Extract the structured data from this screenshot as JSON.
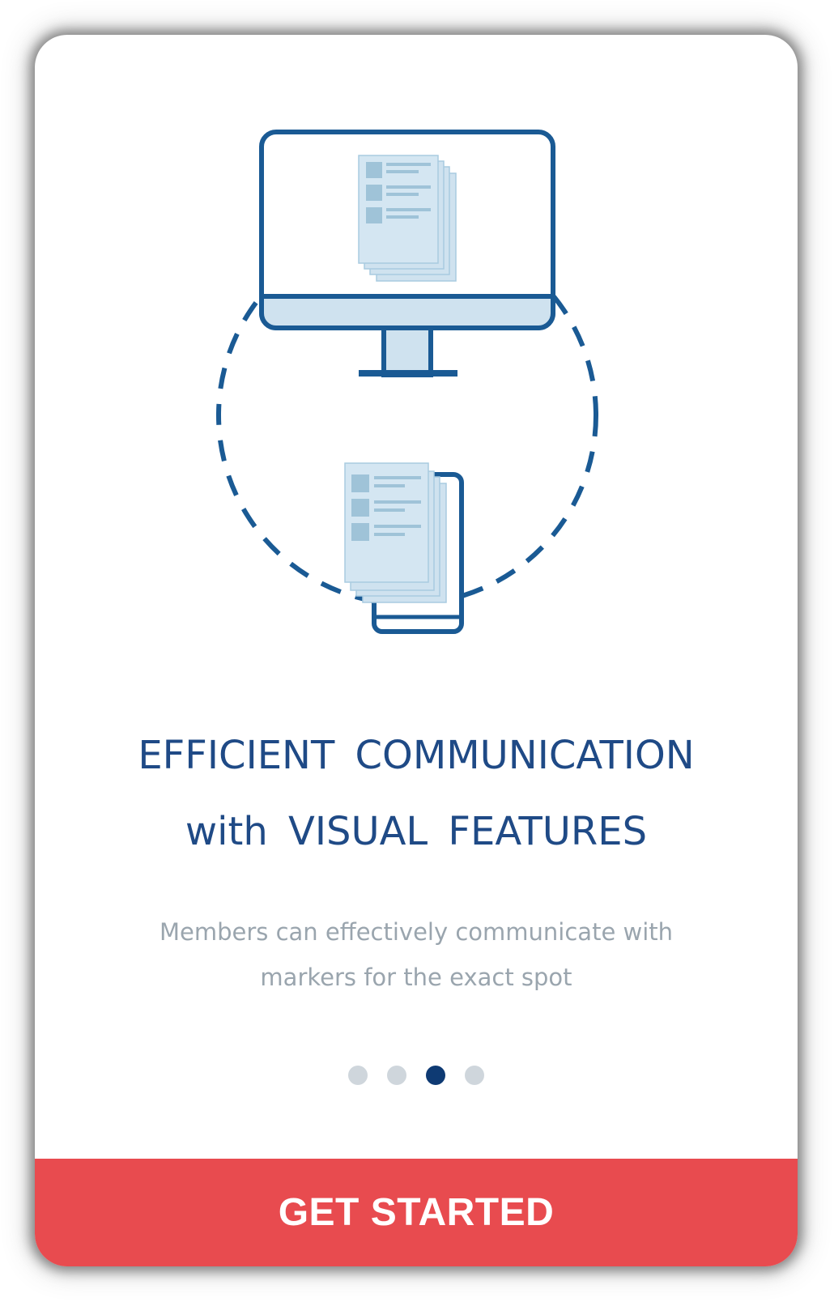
{
  "onboarding": {
    "title_line1": "EFFICIENT COMMUNICATION",
    "title_line2": "with VISUAL FEATURES",
    "description_line1": "Members can effectively communicate with",
    "description_line2": "markers for the exact spot",
    "pagination": {
      "total": 4,
      "active_index": 2
    },
    "cta_label": "GET STARTED"
  },
  "illustration": {
    "icons": [
      "desktop-monitor-icon",
      "document-stack-icon",
      "smartphone-icon",
      "sync-circle-icon"
    ]
  },
  "colors": {
    "primary_blue": "#1f4a86",
    "icon_stroke": "#1a5a94",
    "icon_fill": "#cfe2ef",
    "muted_text": "#9aa5ae",
    "dot_inactive": "#cfd6dc",
    "dot_active": "#0e3a73",
    "cta_background": "#e84b4f",
    "cta_text": "#ffffff"
  }
}
